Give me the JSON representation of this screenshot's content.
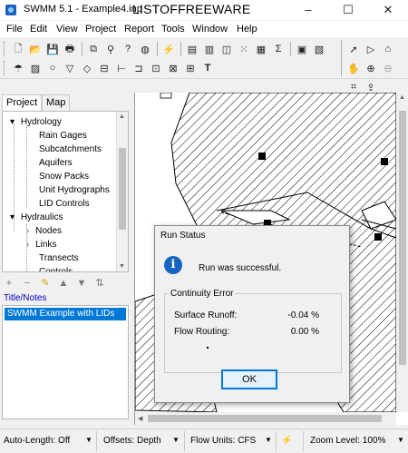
{
  "window": {
    "title": "SWMM 5.1 - Example4.inp",
    "brand": "LISTOFFREEWARE",
    "controls": [
      "–",
      "☐",
      "✕"
    ]
  },
  "menu": [
    "File",
    "Edit",
    "View",
    "Project",
    "Report",
    "Tools",
    "Window",
    "Help"
  ],
  "toolbar": {
    "row1_icons": [
      "new-icon",
      "open-icon",
      "save-icon",
      "print-icon",
      "copy-icon",
      "find-icon",
      "query-icon",
      "overview-icon",
      "run-icon",
      "report-icon",
      "graph-icon",
      "profile-icon",
      "scatter-icon",
      "table-icon",
      "statistics-icon",
      "options-icon",
      "pan-icon"
    ],
    "row2_icons": [
      "raingage-icon",
      "subcatchment-icon",
      "junction-icon",
      "outfall-icon",
      "divider-icon",
      "storage-icon",
      "conduit-icon",
      "pump-icon",
      "orifice-icon",
      "weir-icon",
      "outlet-icon",
      "label-icon"
    ],
    "right_icons": [
      "select-icon",
      "vertex-icon",
      "region-icon",
      "pan-icon",
      "zoom-in-icon",
      "zoom-out-icon",
      "full-extent-icon",
      "measure-icon"
    ]
  },
  "left_panel": {
    "tabs": [
      "Project",
      "Map"
    ],
    "tree": [
      {
        "label": "Hydrology",
        "level": 0,
        "expander": "▾"
      },
      {
        "label": "Rain Gages",
        "level": 1
      },
      {
        "label": "Subcatchments",
        "level": 1
      },
      {
        "label": "Aquifers",
        "level": 1
      },
      {
        "label": "Snow Packs",
        "level": 1
      },
      {
        "label": "Unit Hydrographs",
        "level": 1
      },
      {
        "label": "LID Controls",
        "level": 1
      },
      {
        "label": "Hydraulics",
        "level": 0,
        "expander": "▾"
      },
      {
        "label": "Nodes",
        "level": 1,
        "expander": "›"
      },
      {
        "label": "Links",
        "level": 1,
        "expander": "›"
      },
      {
        "label": "Transects",
        "level": 1
      },
      {
        "label": "Controls",
        "level": 1
      }
    ],
    "mini_toolbar": [
      "+",
      "−",
      "✎",
      "▲",
      "▼",
      "⇅"
    ],
    "title_notes_label": "Title/Notes",
    "title_notes_value": "SWMM Example with LIDs"
  },
  "dialog": {
    "title": "Run Status",
    "message": "Run was successful.",
    "group_label": "Continuity Error",
    "rows": [
      {
        "label": "Surface Runoff:",
        "value": "-0.04 %"
      },
      {
        "label": "Flow Routing:",
        "value": "0.00 %"
      }
    ],
    "ok_label": "OK"
  },
  "status": {
    "auto_length": "Auto-Length: Off",
    "offsets": "Offsets: Depth",
    "flow_units": "Flow Units: CFS",
    "zoom": "Zoom Level: 100%"
  }
}
